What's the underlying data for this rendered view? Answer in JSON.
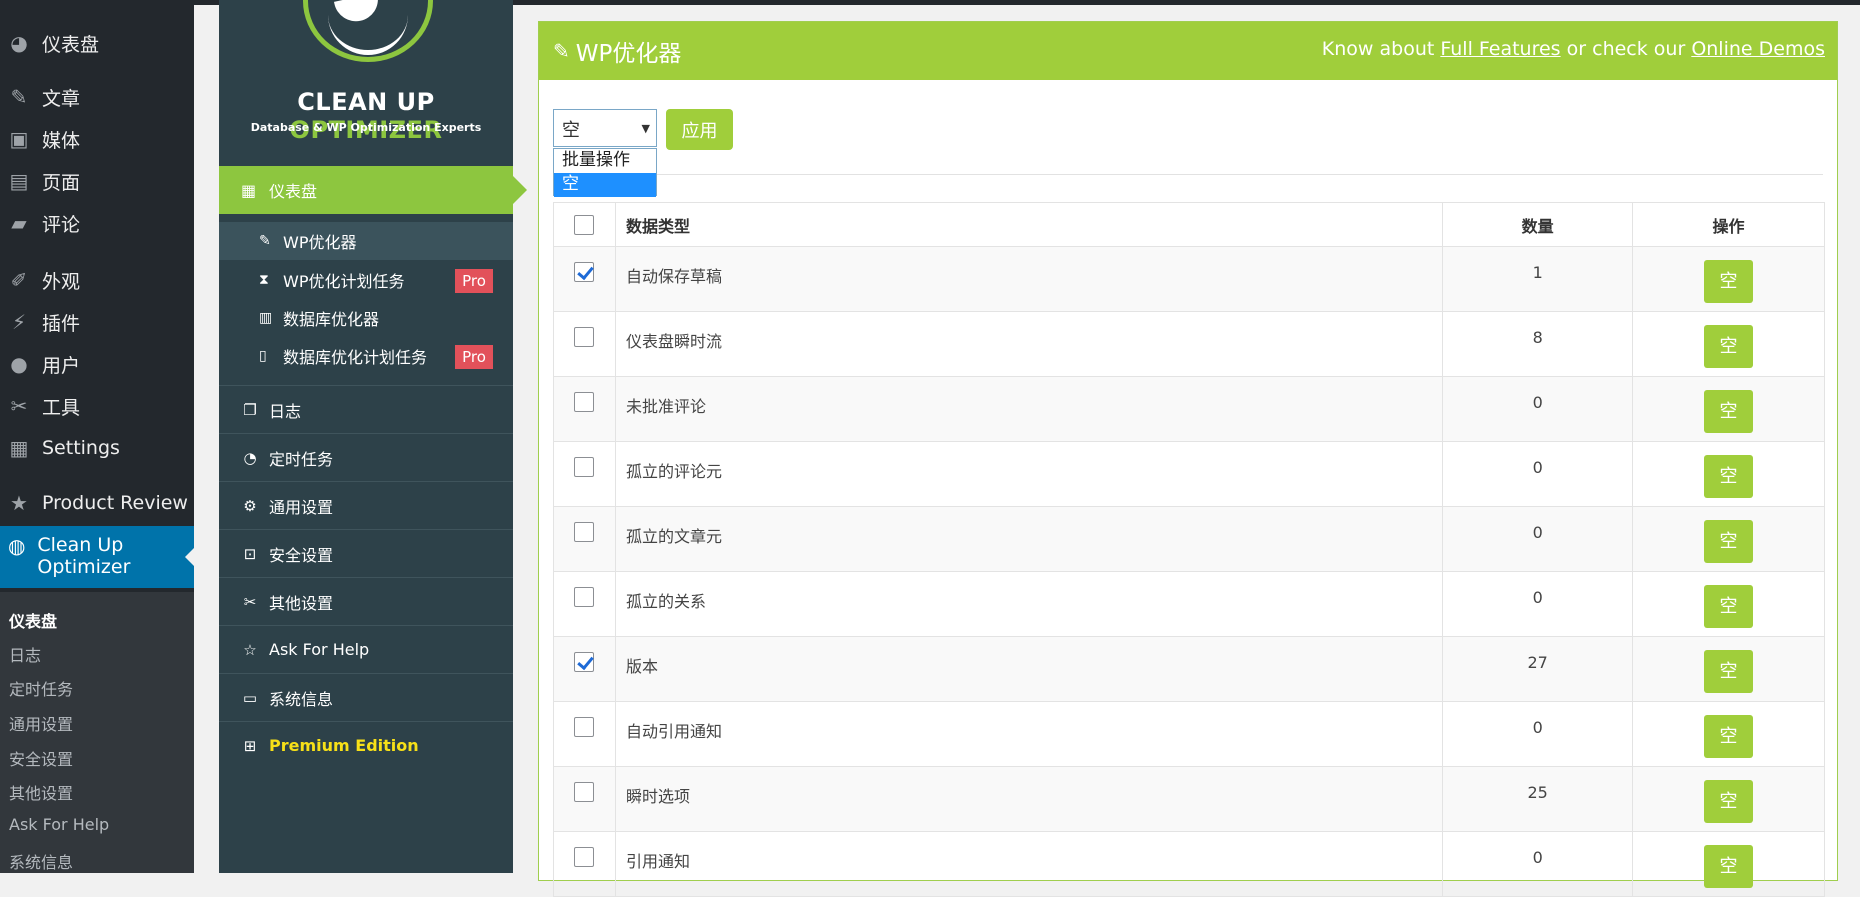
{
  "wp_menu": {
    "items": [
      {
        "icon": "dashboard-icon",
        "glyph": "◕",
        "label": "仪表盘"
      },
      {
        "icon": "pin-icon",
        "glyph": "✎",
        "label": "文章"
      },
      {
        "icon": "media-icon",
        "glyph": "▣",
        "label": "媒体"
      },
      {
        "icon": "page-icon",
        "glyph": "▤",
        "label": "页面"
      },
      {
        "icon": "comment-icon",
        "glyph": "▰",
        "label": "评论"
      },
      {
        "icon": "appearance-icon",
        "glyph": "✐",
        "label": "外观"
      },
      {
        "icon": "plugin-icon",
        "glyph": "⚡",
        "label": "插件"
      },
      {
        "icon": "user-icon",
        "glyph": "●",
        "label": "用户"
      },
      {
        "icon": "tools-icon",
        "glyph": "✂",
        "label": "工具"
      },
      {
        "icon": "settings-icon",
        "glyph": "▦",
        "label": "Settings"
      },
      {
        "icon": "star-icon",
        "glyph": "★",
        "label": "Product Review"
      },
      {
        "icon": "cleanup-icon",
        "glyph": "◍",
        "label": "Clean Up Optimizer"
      }
    ],
    "submenu": [
      "仪表盘",
      "日志",
      "定时任务",
      "通用设置",
      "安全设置",
      "其他设置",
      "Ask For Help",
      "系统信息"
    ]
  },
  "plugin_nav": {
    "brand_a": "CLEAN UP",
    "brand_b": "OPTIMIZER",
    "tagline": "Database & WP Optimization Experts",
    "dashboard": {
      "icon": "grid-icon",
      "glyph": "▦",
      "label": "仪表盘"
    },
    "sub_items": [
      {
        "icon": "edit-icon",
        "glyph": "✎",
        "label": "WP优化器",
        "pro": ""
      },
      {
        "icon": "hourglass-icon",
        "glyph": "⧗",
        "label": "WP优化计划任务",
        "pro": "Pro"
      },
      {
        "icon": "book-icon",
        "glyph": "▥",
        "label": "数据库优化器",
        "pro": ""
      },
      {
        "icon": "tablet-icon",
        "glyph": "▯",
        "label": "数据库优化计划任务",
        "pro": "Pro"
      }
    ],
    "rows": [
      {
        "icon": "copy-icon",
        "glyph": "❐",
        "label": "日志"
      },
      {
        "icon": "gauge-icon",
        "glyph": "◔",
        "label": "定时任务"
      },
      {
        "icon": "gear-icon",
        "glyph": "⚙",
        "label": "通用设置"
      },
      {
        "icon": "lock-icon",
        "glyph": "⊡",
        "label": "安全设置"
      },
      {
        "icon": "wrench-icon",
        "glyph": "✂",
        "label": "其他设置"
      },
      {
        "icon": "star-outline-icon",
        "glyph": "☆",
        "label": "Ask For Help"
      },
      {
        "icon": "monitor-icon",
        "glyph": "▭",
        "label": "系统信息"
      },
      {
        "icon": "briefcase-icon",
        "glyph": "⊞",
        "label": "Premium Edition"
      }
    ]
  },
  "header": {
    "title": "WP优化器",
    "know_about": "Know about",
    "full_features": "Full Features",
    "or_check": "or check our",
    "online_demos": "Online Demos"
  },
  "bulk": {
    "selected": "空",
    "apply": "应用",
    "options": [
      "批量操作",
      "空"
    ]
  },
  "table": {
    "headers": {
      "type": "数据类型",
      "count": "数量",
      "action": "操作"
    },
    "rows": [
      {
        "type": "自动保存草稿",
        "count": "1",
        "checked": true,
        "action": "空"
      },
      {
        "type": "仪表盘瞬时流",
        "count": "8",
        "checked": false,
        "action": "空"
      },
      {
        "type": "未批准评论",
        "count": "0",
        "checked": false,
        "action": "空"
      },
      {
        "type": "孤立的评论元",
        "count": "0",
        "checked": false,
        "action": "空"
      },
      {
        "type": "孤立的文章元",
        "count": "0",
        "checked": false,
        "action": "空"
      },
      {
        "type": "孤立的关系",
        "count": "0",
        "checked": false,
        "action": "空"
      },
      {
        "type": "版本",
        "count": "27",
        "checked": true,
        "action": "空"
      },
      {
        "type": "自动引用通知",
        "count": "0",
        "checked": false,
        "action": "空"
      },
      {
        "type": "瞬时选项",
        "count": "25",
        "checked": false,
        "action": "空"
      },
      {
        "type": "引用通知",
        "count": "0",
        "checked": false,
        "action": "空"
      }
    ]
  }
}
